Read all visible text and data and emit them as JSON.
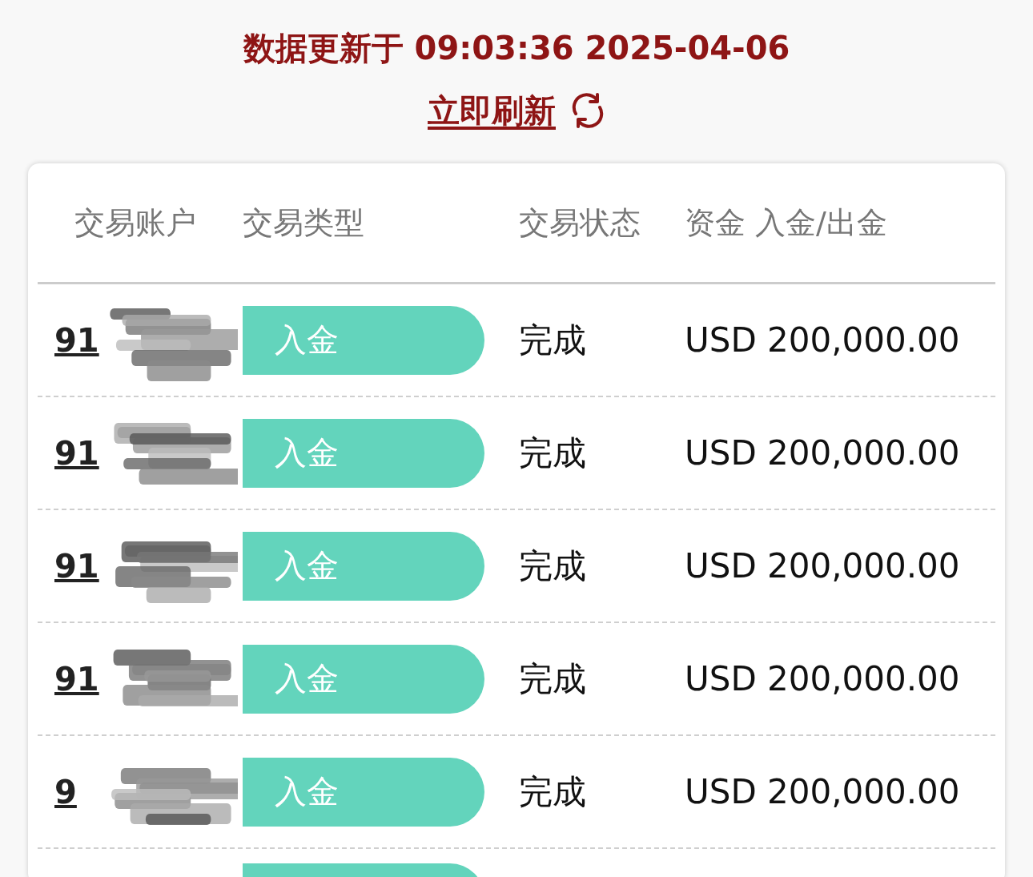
{
  "update_notice": "数据更新于 09:03:36 2025-04-06",
  "refresh_link": "立即刷新",
  "table": {
    "columns": [
      "交易账户",
      "交易类型",
      "交易状态",
      "资金 入金/出金"
    ],
    "rows": [
      {
        "kind": "full",
        "account": "91",
        "type": "入金",
        "status": "完成",
        "amount": "USD 200,000.00"
      },
      {
        "kind": "full",
        "account": "91",
        "type": "入金",
        "status": "完成",
        "amount": "USD 200,000.00"
      },
      {
        "kind": "full",
        "account": "91",
        "type": "入金",
        "status": "完成",
        "amount": "USD 200,000.00"
      },
      {
        "kind": "full",
        "account": "91",
        "type": "入金",
        "status": "完成",
        "amount": "USD 200,000.00"
      },
      {
        "kind": "full",
        "account": "9",
        "type": "入金",
        "status": "完成",
        "amount": "USD 200,000.00"
      },
      {
        "kind": "cut"
      }
    ]
  }
}
